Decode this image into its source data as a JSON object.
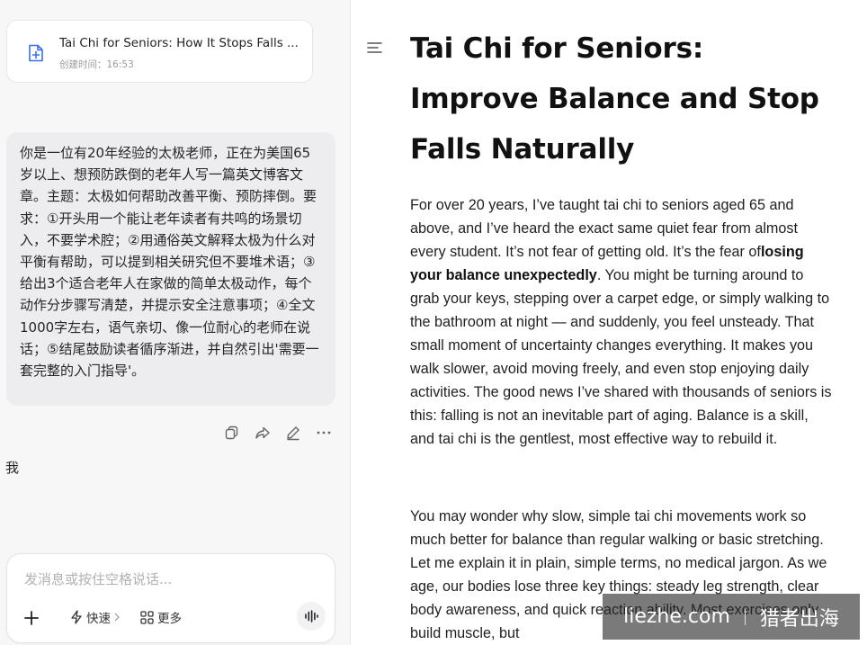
{
  "file_card": {
    "title": "Tai Chi for Seniors: How It Stops Falls ...",
    "created": "创建时间：16:53"
  },
  "prompt": {
    "text": "你是一位有20年经验的太极老师，正在为美国65岁以上、想预防跌倒的老年人写一篇英文博客文章。主题：太极如何帮助改善平衡、预防摔倒。要求：①开头用一个能让老年读者有共鸣的场景切入，不要学术腔；②用通俗英文解释太极为什么对平衡有帮助，可以提到相关研究但不要堆术语；③给出3个适合老年人在家做的简单太极动作，每个动作分步骤写清楚，并提示安全注意事项；④全文1000字左右，语气亲切、像一位耐心的老师在说话；⑤结尾鼓励读者循序渐进，并自然引出'需要一套完整的入门指导'。"
  },
  "sender_label": "我",
  "composer": {
    "placeholder": "发消息或按住空格说话...",
    "fast_label": "快速",
    "more_label": "更多"
  },
  "article": {
    "title": "Tai Chi for Seniors: Improve Balance and Stop Falls Naturally",
    "p1_before": "For over 20 years, I’ve taught tai chi to seniors aged 65 and above, and I’ve heard the exact same quiet fear from almost every student. It’s not fear of getting old. It’s the fear of",
    "p1_bold": "losing your balance unexpectedly",
    "p1_after": ". You might be turning around to grab your keys, stepping over a carpet edge, or simply walking to the bathroom at night — and suddenly, you feel unsteady. That small moment of uncertainty changes everything. It makes you walk slower, avoid moving freely, and even stop enjoying daily activities. The good news I’ve shared with thousands of seniors is this: falling is not an inevitable part of aging. Balance is a skill, and tai chi is the gentlest, most effective way to rebuild it.",
    "p2": "You may wonder why slow, simple tai chi movements work so much better for balance than regular walking or basic stretching. Let me explain it in plain, simple terms, no medical jargon. As we age, our bodies lose three key things: steady leg strength, clear body awareness, and quick reaction ability. Most exercises only build muscle, but"
  },
  "watermark": {
    "site": "liezhe.com",
    "brand": "猎者出海"
  },
  "colors": {
    "accent_blue": "#3a6df0",
    "panel_bg": "#f7f7f8",
    "bubble_bg": "#ededf0"
  }
}
